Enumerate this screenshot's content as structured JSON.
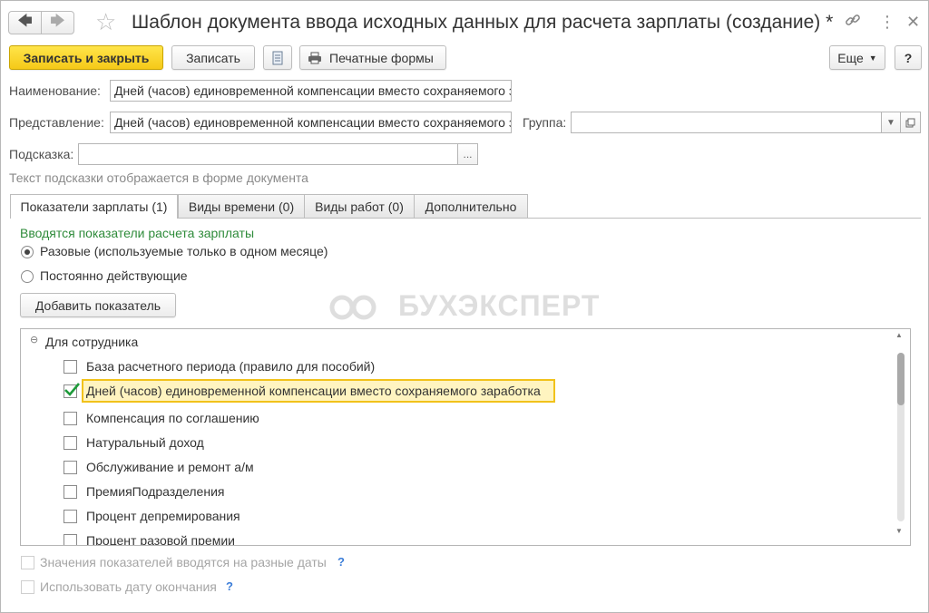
{
  "window": {
    "title": "Шаблон документа ввода исходных данных для расчета зарплаты (создание) *",
    "back_icon": "arrow-left-icon",
    "forward_icon": "arrow-right-icon",
    "favorite_icon": "star-icon",
    "link_icon": "link-icon",
    "menu_icon": "more-vertical-icon",
    "close_icon": "close-icon"
  },
  "toolbar": {
    "save_close_label": "Записать и закрыть",
    "save_label": "Записать",
    "print_label": "Печатные формы",
    "more_label": "Еще",
    "help_label": "?"
  },
  "form": {
    "name_label": "Наименование:",
    "name_value": "Дней (часов) единовременной компенсации вместо сохраняемого заработка",
    "presentation_label": "Представление:",
    "presentation_value": "Дней (часов) единовременной компенсации вместо сохраняемого заработка",
    "group_label": "Группа:",
    "group_value": "",
    "hint_label": "Подсказка:",
    "hint_value": "",
    "hint_button": "...",
    "hint_note": "Текст подсказки отображается в форме документа"
  },
  "tabs": [
    {
      "label": "Показатели зарплаты (1)",
      "active": true
    },
    {
      "label": "Виды времени (0)",
      "active": false
    },
    {
      "label": "Виды работ (0)",
      "active": false
    },
    {
      "label": "Дополнительно",
      "active": false
    }
  ],
  "indicators": {
    "caption": "Вводятся показатели расчета зарплаты",
    "radio_one_time": "Разовые (используемые только в одном месяце)",
    "radio_permanent": "Постоянно действующие",
    "selected": "one_time",
    "add_button": "Добавить показатель",
    "group_title": "Для сотрудника",
    "items": [
      {
        "label": "База расчетного периода (правило для пособий)",
        "checked": false
      },
      {
        "label": "Дней (часов) единовременной компенсации вместо сохраняемого заработка",
        "checked": true
      },
      {
        "label": "Компенсация по соглашению",
        "checked": false
      },
      {
        "label": "Натуральный доход",
        "checked": false
      },
      {
        "label": "Обслуживание и ремонт а/м",
        "checked": false
      },
      {
        "label": "ПремияПодразделения",
        "checked": false
      },
      {
        "label": "Процент депремирования",
        "checked": false
      },
      {
        "label": "Процент разовой премии",
        "checked": false
      }
    ],
    "values_different_dates": "Значения показателей вводятся на разные даты",
    "use_end_date": "Использовать дату окончания",
    "help_mark": "?"
  },
  "watermark": "БУХЭКСПЕРТ",
  "colors": {
    "primary_button": "#f5c918",
    "highlight_border": "#f1c21b",
    "caption_green": "#2e8b3a",
    "help_blue": "#3b7dd8"
  }
}
